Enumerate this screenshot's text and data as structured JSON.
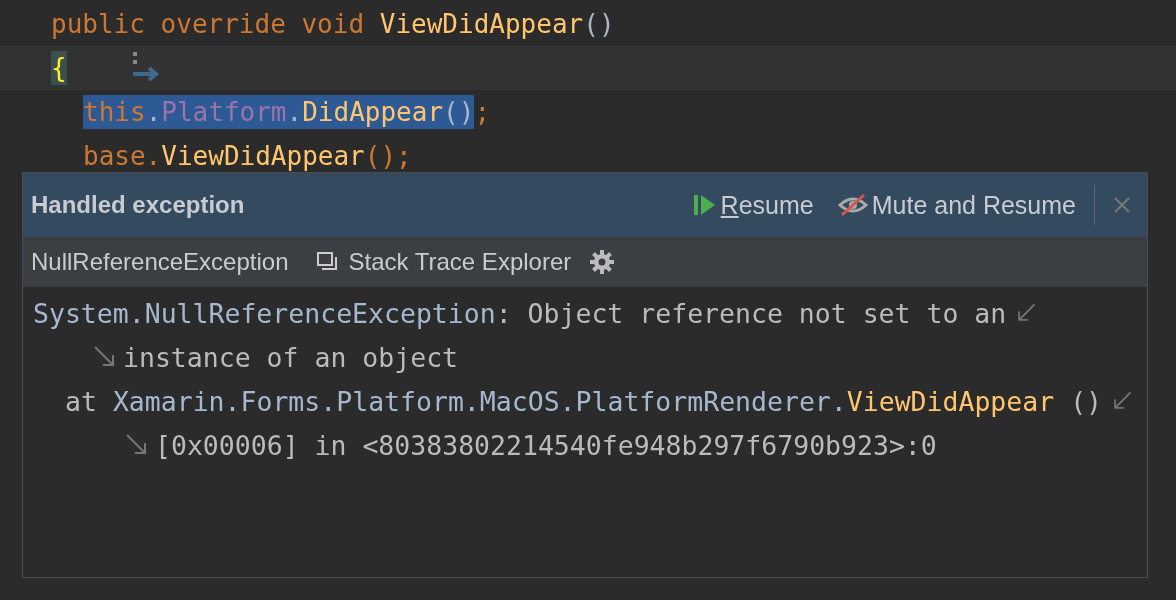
{
  "editor": {
    "lines": [
      {
        "current": false,
        "tokens": [
          {
            "text": "public override void ",
            "kind": "keyword",
            "selected": false
          },
          {
            "text": "ViewDidAppear",
            "kind": "method",
            "selected": false
          },
          {
            "text": "()",
            "kind": "plain",
            "selected": false
          }
        ]
      },
      {
        "current": true,
        "tokens": [
          {
            "text": "{",
            "kind": "brace-match",
            "selected": false
          }
        ]
      },
      {
        "current": false,
        "tokens": [
          {
            "text": "this",
            "kind": "keyword",
            "selected": true
          },
          {
            "text": ".",
            "kind": "plain",
            "selected": true
          },
          {
            "text": "Platform",
            "kind": "property",
            "selected": true
          },
          {
            "text": ".",
            "kind": "plain",
            "selected": true
          },
          {
            "text": "DidAppear",
            "kind": "method",
            "selected": true
          },
          {
            "text": "()",
            "kind": "plain",
            "selected": true
          },
          {
            "text": ";",
            "kind": "keyword",
            "selected": false
          }
        ]
      },
      {
        "current": false,
        "tokens": [
          {
            "text": "base.",
            "kind": "keyword",
            "selected": false
          },
          {
            "text": "ViewDidAppear",
            "kind": "method",
            "selected": false
          },
          {
            "text": "();",
            "kind": "keyword",
            "selected": false
          }
        ]
      }
    ]
  },
  "popup": {
    "title": "Handled exception",
    "actions": [
      {
        "kind": "resume",
        "label": "Resume"
      },
      {
        "kind": "mute",
        "label": "Mute and Resume"
      }
    ],
    "exception_name": "NullReferenceException",
    "stack_trace_button": "Stack Trace Explorer",
    "trace": [
      {
        "kind": "message",
        "wraps": true,
        "segments": [
          {
            "text": "System.NullReferenceException",
            "kind": "link"
          },
          {
            "text": ": Object reference not set to an",
            "kind": "plain"
          }
        ]
      },
      {
        "kind": "continuation",
        "wraps": false,
        "segments": [
          {
            "text": "instance of an object",
            "kind": "plain"
          }
        ]
      },
      {
        "kind": "frame",
        "wraps": true,
        "segments": [
          {
            "text": "at ",
            "kind": "plain"
          },
          {
            "text": "Xamarin.Forms.Platform.MacOS.PlatformRenderer.",
            "kind": "link"
          },
          {
            "text": "ViewDidAppear",
            "kind": "method"
          },
          {
            "text": " ()",
            "kind": "plain"
          }
        ]
      },
      {
        "kind": "frame-continuation",
        "wraps": false,
        "segments": [
          {
            "text": "[0x00006] in <80383802214540fe948b297f6790b923>:0",
            "kind": "plain"
          }
        ]
      }
    ]
  }
}
